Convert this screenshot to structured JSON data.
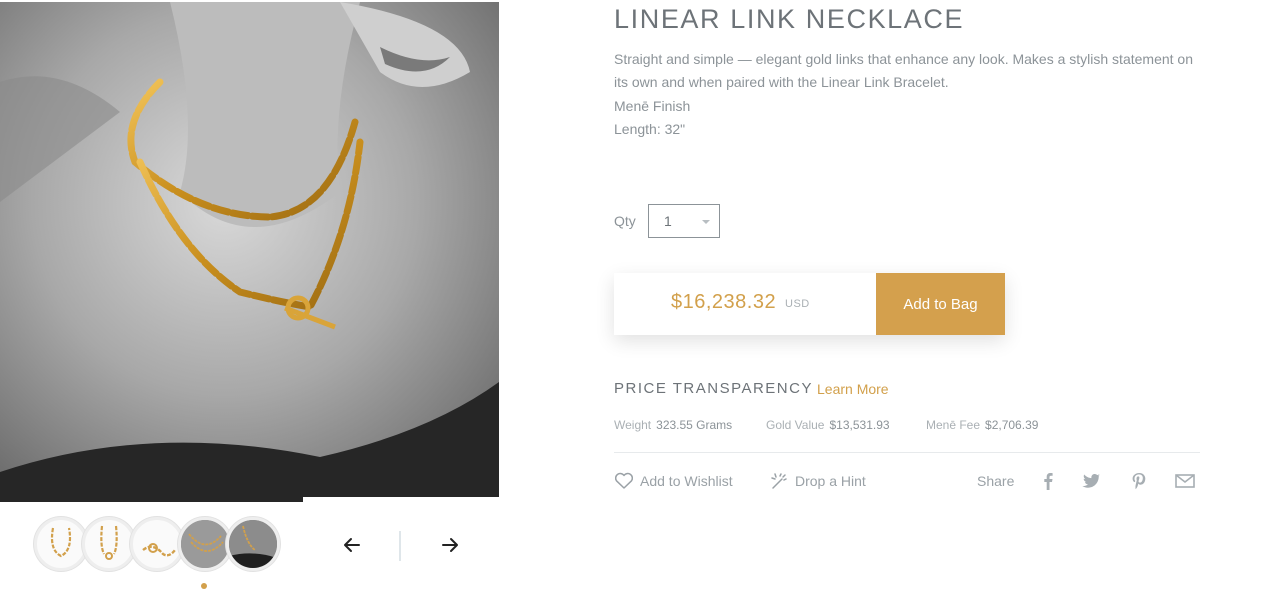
{
  "product": {
    "title": "LINEAR LINK NECKLACE",
    "description_lines": [
      "Straight and simple — elegant gold links that enhance any look. Makes a stylish statement on its own and when paired with the Linear Link Bracelet.",
      "Menē Finish",
      "Length: 32\""
    ]
  },
  "quantity": {
    "label": "Qty",
    "value": "1"
  },
  "buy": {
    "price": "$16,238.32",
    "currency": "USD",
    "add_label": "Add to Bag"
  },
  "price_transparency": {
    "label": "PRICE TRANSPARENCY",
    "learn_more": "Learn More",
    "weight": {
      "key": "Weight",
      "value": "323.55 Grams"
    },
    "gold_value": {
      "key": "Gold Value",
      "value": "$13,531.93"
    },
    "fee": {
      "key": "Menē Fee",
      "value": "$2,706.39"
    }
  },
  "actions": {
    "wishlist": "Add to Wishlist",
    "hint": "Drop a Hint",
    "share": "Share"
  },
  "colors": {
    "accent": "#d2a04b",
    "button": "#d4a04d",
    "text": "#8c9398",
    "heading": "#6d7378"
  },
  "icons": [
    "arrow-left-icon",
    "arrow-right-icon",
    "heart-icon",
    "sparkle-icon",
    "facebook-icon",
    "twitter-icon",
    "pinterest-icon",
    "mail-icon"
  ]
}
